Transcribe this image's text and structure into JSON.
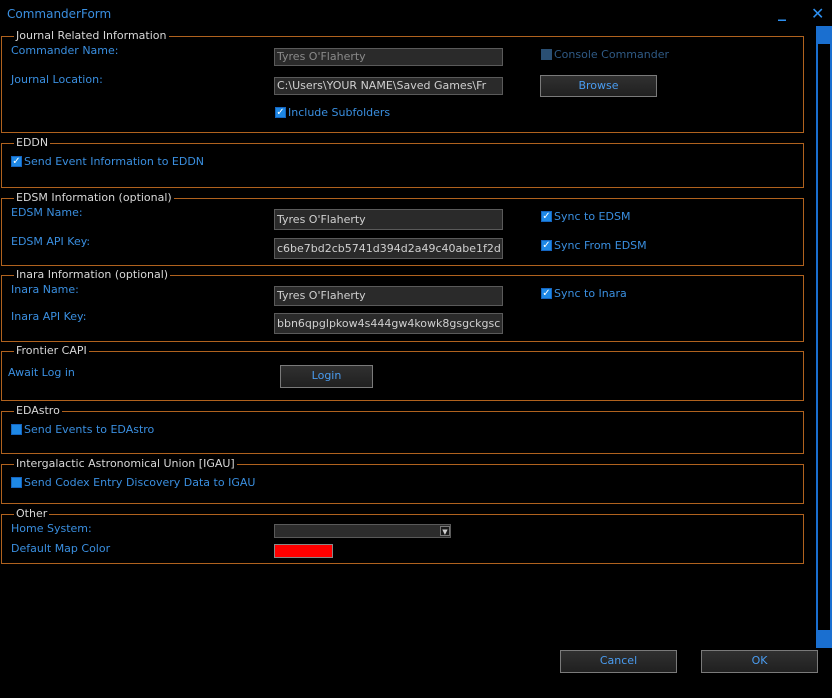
{
  "window": {
    "title": "CommanderForm",
    "minimize": "_",
    "close": "✕"
  },
  "journal": {
    "legend": "Journal Related Information",
    "commander_label": "Commander Name:",
    "commander_value": "Tyres O'Flaherty",
    "location_label": "Journal Location:",
    "location_value": "C:\\Users\\YOUR NAME\\Saved Games\\Fr",
    "console_label": "Console Commander",
    "browse_label": "Browse",
    "subfolders_label": "Include Subfolders",
    "console_checked": false,
    "subfolders_checked": true
  },
  "eddn": {
    "legend": "EDDN",
    "send_label": "Send Event Information to EDDN",
    "send_checked": true
  },
  "edsm": {
    "legend": "EDSM Information (optional)",
    "name_label": "EDSM Name:",
    "name_value": "Tyres O'Flaherty",
    "key_label": "EDSM API Key:",
    "key_value": "c6be7bd2cb5741d394d2a49c40abe1f2d",
    "sync_to_label": "Sync to EDSM",
    "sync_from_label": "Sync From EDSM"
  },
  "inara": {
    "legend": "Inara Information (optional)",
    "name_label": "Inara Name:",
    "name_value": "Tyres O'Flaherty",
    "key_label": "Inara API Key:",
    "key_value": "bbn6qpglpkow4s444gw4kowk8gsgckgsc",
    "sync_label": "Sync to Inara"
  },
  "capi": {
    "legend": "Frontier CAPI",
    "status": "Await Log in",
    "login_label": "Login"
  },
  "edastro": {
    "legend": "EDAstro",
    "send_label": "Send Events to EDAstro",
    "send_checked": false
  },
  "igau": {
    "legend": "Intergalactic Astronomical Union [IGAU]",
    "send_label": "Send Codex Entry Discovery Data to IGAU",
    "send_checked": false
  },
  "other": {
    "legend": "Other",
    "home_label": "Home System:",
    "home_value": "",
    "map_color_label": "Default Map Color",
    "map_color": "#ff0000"
  },
  "footer": {
    "cancel_label": "Cancel",
    "ok_label": "OK"
  },
  "icons": {
    "check": "✓",
    "dropdown": "▼"
  },
  "colors": {
    "accent": "#3a8fe0",
    "border": "#b0621e",
    "checkbox": "#1e88e5"
  }
}
